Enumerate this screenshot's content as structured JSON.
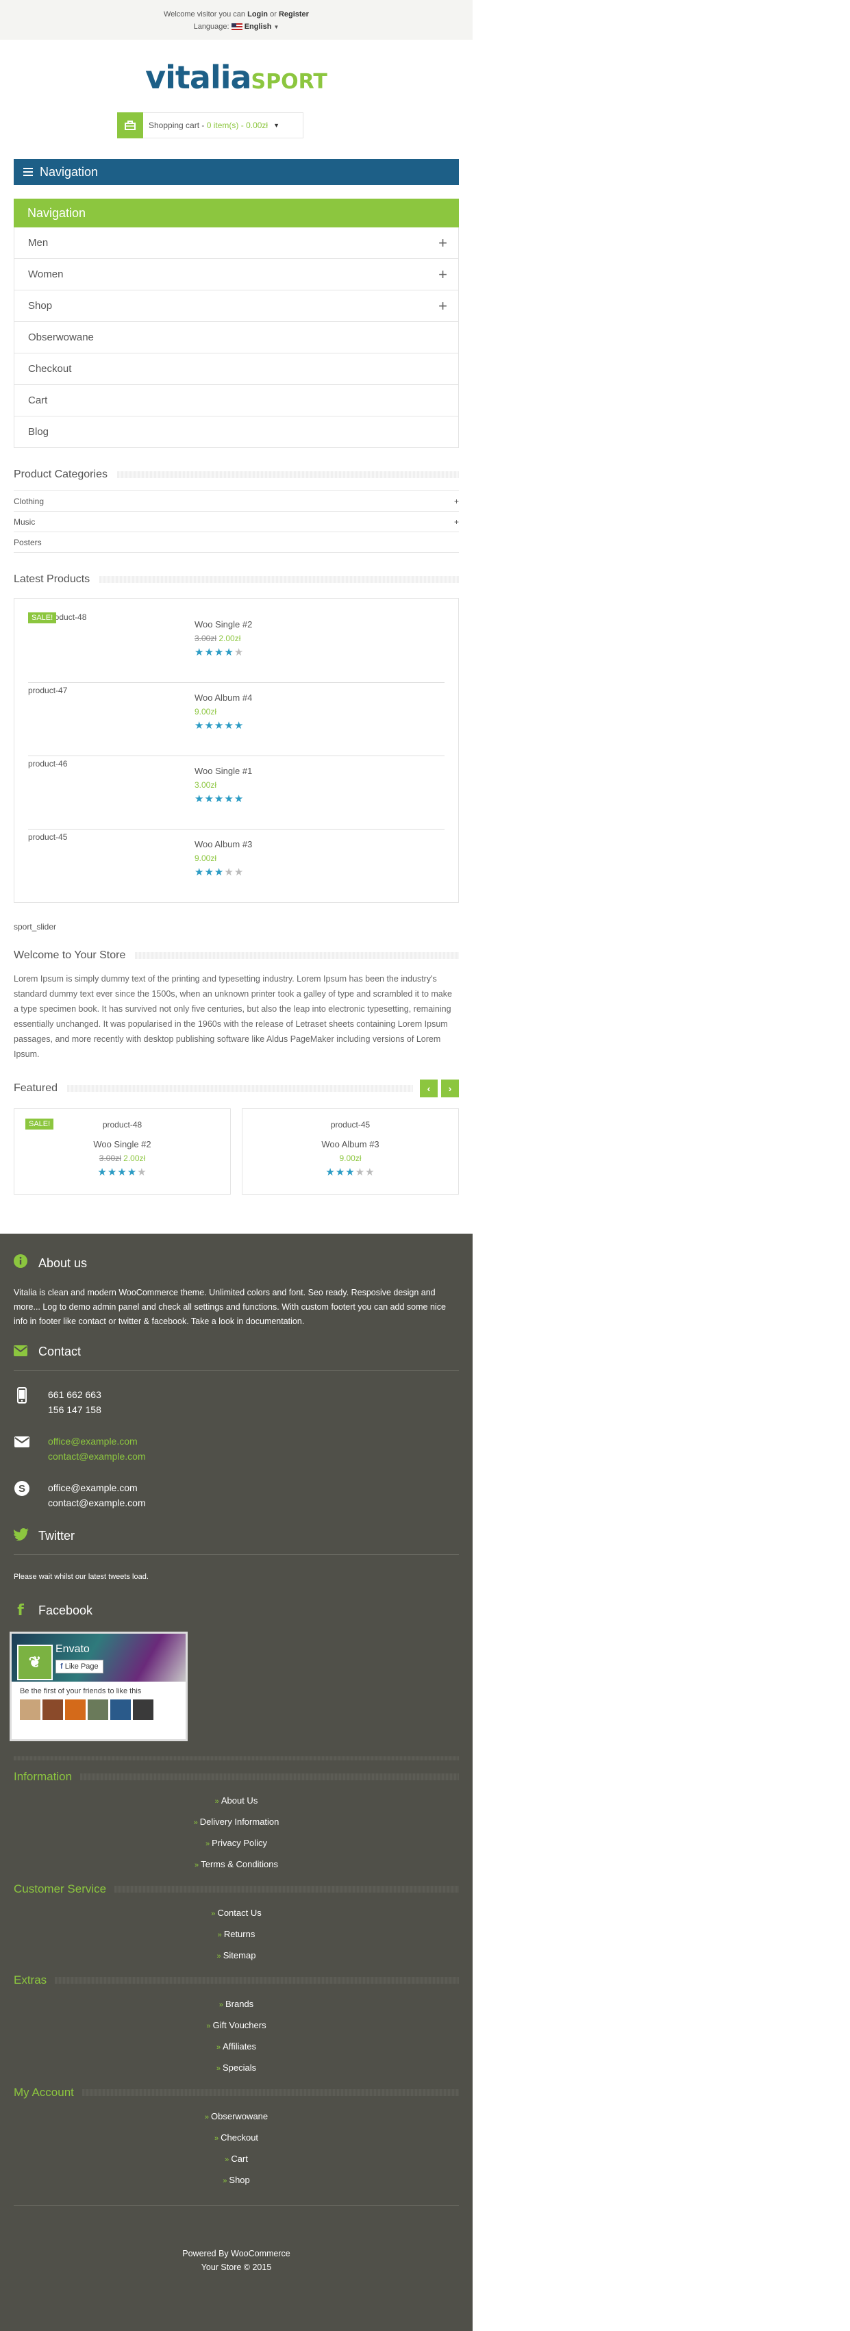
{
  "topbar": {
    "welcome_prefix": "Welcome visitor you can",
    "login": "Login",
    "or": "or",
    "register": "Register",
    "language_label": "Language:",
    "language_value": "English"
  },
  "logo": {
    "main": "vitalia",
    "accent": "SPORT"
  },
  "cart": {
    "label": "Shopping cart -",
    "summary": "0 item(s) - 0.00zł"
  },
  "nav": {
    "toggle_label": "Navigation",
    "header": "Navigation",
    "items": [
      {
        "label": "Men",
        "has_children": "+"
      },
      {
        "label": "Women",
        "has_children": "+"
      },
      {
        "label": "Shop",
        "has_children": "+"
      },
      {
        "label": "Obserwowane",
        "has_children": ""
      },
      {
        "label": "Checkout",
        "has_children": ""
      },
      {
        "label": "Cart",
        "has_children": ""
      },
      {
        "label": "Blog",
        "has_children": ""
      }
    ]
  },
  "categories": {
    "title": "Product Categories",
    "items": [
      {
        "label": "Clothing",
        "toggle": "+"
      },
      {
        "label": "Music",
        "toggle": "+"
      },
      {
        "label": "Posters",
        "toggle": ""
      }
    ]
  },
  "latest": {
    "title": "Latest Products",
    "sale_badge": "SALE!",
    "items": [
      {
        "image_alt": "product-48",
        "name": "Woo Single #2",
        "old_price": "3.00zł",
        "price": "2.00zł",
        "rating": 4
      },
      {
        "image_alt": "product-47",
        "name": "Woo Album #4",
        "old_price": "",
        "price": "9.00zł",
        "rating": 5
      },
      {
        "image_alt": "product-46",
        "name": "Woo Single #1",
        "old_price": "",
        "price": "3.00zł",
        "rating": 5
      },
      {
        "image_alt": "product-45",
        "name": "Woo Album #3",
        "old_price": "",
        "price": "9.00zł",
        "rating": 3
      }
    ]
  },
  "slider_label": "sport_slider",
  "welcome": {
    "title": "Welcome to Your Store",
    "text": "Lorem Ipsum is simply dummy text of the printing and typesetting industry. Lorem Ipsum has been the industry's standard dummy text ever since the 1500s, when an unknown printer took a galley of type and scrambled it to make a type specimen book. It has survived not only five centuries, but also the leap into electronic typesetting, remaining essentially unchanged. It was popularised in the 1960s with the release of Letraset sheets containing Lorem Ipsum passages, and more recently with desktop publishing software like Aldus PageMaker including versions of Lorem Ipsum."
  },
  "featured": {
    "title": "Featured",
    "prev": "‹",
    "next": "›",
    "sale_badge": "SALE!",
    "items": [
      {
        "image_alt": "product-48",
        "name": "Woo Single #2",
        "old_price": "3.00zł",
        "price": "2.00zł",
        "rating": 4
      },
      {
        "image_alt": "product-45",
        "name": "Woo Album #3",
        "old_price": "",
        "price": "9.00zł",
        "rating": 3
      }
    ]
  },
  "footer": {
    "about": {
      "title": "About us",
      "text": "Vitalia is clean and modern WooCommerce theme. Unlimited colors and font. Seo ready. Resposive design and more... Log to demo admin panel and check all settings and functions. With custom footert you can add some nice info in footer like contact or twitter & facebook. Take a look in documentation."
    },
    "contact": {
      "title": "Contact",
      "phone1": "661 662 663",
      "phone2": "156 147 158",
      "email1": "office@example.com",
      "email2": "contact@example.com",
      "skype1": "office@example.com",
      "skype2": "contact@example.com"
    },
    "twitter": {
      "title": "Twitter",
      "text": "Please wait whilst our latest tweets load."
    },
    "facebook": {
      "title": "Facebook",
      "page_name": "Envato",
      "like_button": "Like Page",
      "friends_text": "Be the first of your friends to like this"
    },
    "links": [
      {
        "title": "Information",
        "items": [
          "About Us",
          "Delivery Information",
          "Privacy Policy",
          "Terms & Conditions"
        ]
      },
      {
        "title": "Customer Service",
        "items": [
          "Contact Us",
          "Returns",
          "Sitemap"
        ]
      },
      {
        "title": "Extras",
        "items": [
          "Brands",
          "Gift Vouchers",
          "Affiliates",
          "Specials"
        ]
      },
      {
        "title": "My Account",
        "items": [
          "Obserwowane",
          "Checkout",
          "Cart",
          "Shop"
        ]
      }
    ],
    "powered": "Powered By WooCommerce",
    "copyright": "Your Store © 2015"
  },
  "colors": {
    "accent": "#8cc63f",
    "brand": "#1d5f87",
    "footer_bg": "#505049",
    "star": "#2a9bc4"
  }
}
